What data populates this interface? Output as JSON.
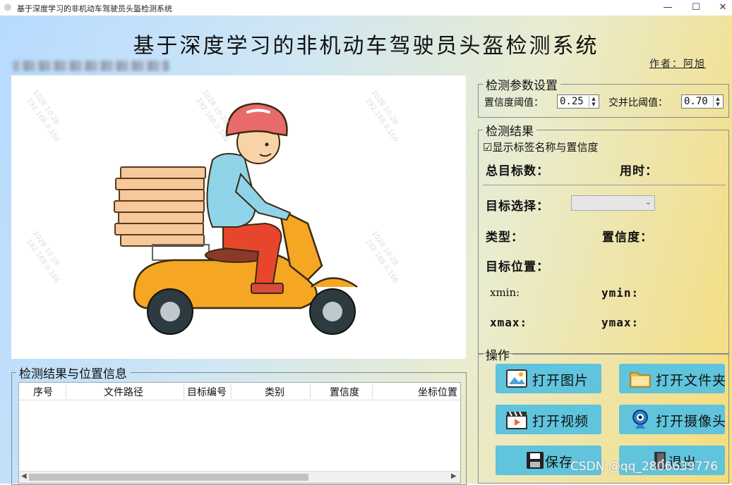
{
  "window": {
    "title": "基于深度学习的非机动车驾驶员头盔检测系统",
    "min_label": "—",
    "max_label": "☐",
    "close_label": "✕"
  },
  "header": {
    "title": "基于深度学习的非机动车驾驶员头盔检测系统",
    "author": "作者：阿旭"
  },
  "watermarks": [
    "1028 10:28",
    "192.168.0.166"
  ],
  "params": {
    "legend": "检测参数设置",
    "conf_label": "置信度阈值：",
    "conf_value": "0.25",
    "iou_label": "交并比阈值：",
    "iou_value": "0.70"
  },
  "results": {
    "legend": "检测结果",
    "show_label_checkbox": "☑显示标签名称与置信度",
    "total_label": "总目标数：",
    "time_label": "用时：",
    "target_select_label": "目标选择：",
    "type_label": "类型：",
    "conf_label": "置信度：",
    "position_label": "目标位置：",
    "xmin_label": "xmin:",
    "ymin_label": "ymin:",
    "xmax_label": "xmax:",
    "ymax_label": "ymax:"
  },
  "operations": {
    "legend": "操作",
    "open_image": "打开图片",
    "open_folder": "打开文件夹",
    "open_video": "打开视频",
    "open_camera": "打开摄像头",
    "save": "保存",
    "exit": "退出"
  },
  "table": {
    "legend": "检测结果与位置信息",
    "columns": [
      "序号",
      "文件路径",
      "目标编号",
      "类别",
      "置信度",
      "坐标位置"
    ]
  },
  "footer": {
    "watermark": "CSDN @qq_2806639776"
  },
  "colors": {
    "button_bg": "#5fc4dc",
    "helmet": "#e86a6a",
    "scooter": "#f5a623"
  }
}
